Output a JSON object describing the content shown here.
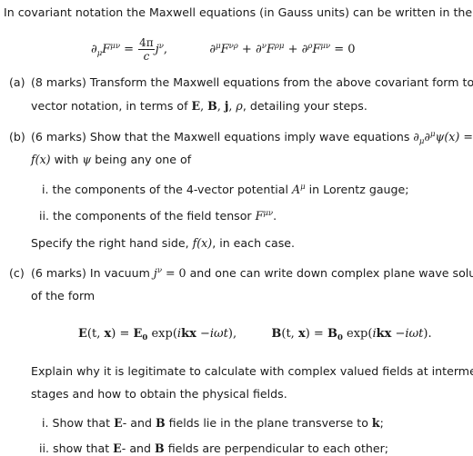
{
  "intro": "In covariant notation the Maxwell equations (in Gauss units) can be written in the form:",
  "equation1": {
    "lhs_op": "∂",
    "lhs_op_sub": "μ",
    "lhs_F": "F",
    "lhs_F_sup": "μν",
    "eq": " = ",
    "frac_num": "4π",
    "frac_den": "c",
    "rhs_j": "j",
    "rhs_j_sup": "ν",
    "comma": ","
  },
  "equation2": {
    "t1_op": "∂",
    "t1_op_sup": "μ",
    "t1_F": "F",
    "t1_F_sup": "νρ",
    "plus1": " + ",
    "t2_op": "∂",
    "t2_op_sup": "ν",
    "t2_F": "F",
    "t2_F_sup": "ρμ",
    "plus2": " + ",
    "t3_op": "∂",
    "t3_op_sup": "ρ",
    "t3_F": "F",
    "t3_F_sup": "μν",
    "rhs": " = 0"
  },
  "part_a": {
    "label": "(a)",
    "marks": "(8 marks)",
    "line1": "Transform the Maxwell equations from the above covariant form to",
    "line2_pre": "vector notation, in terms of ",
    "line2_E": "E",
    "line2_B": "B",
    "line2_j": "j",
    "line2_rho": "ρ",
    "line2_post": ", detailing your steps."
  },
  "part_b": {
    "label": "(b)",
    "marks": "(6 marks)",
    "line1_pre": "Show that the Maxwell equations imply wave equations ",
    "line1_math_op1": "∂",
    "line1_math_op1_sub": "μ",
    "line1_math_op2": "∂",
    "line1_math_op2_sup": "μ",
    "line1_math_psi": "ψ(x)",
    "line1_eq": " =",
    "line2_fx": "f(x)",
    "line2_mid": " with ",
    "line2_psi": "ψ",
    "line2_post": " being any one of",
    "items": [
      {
        "marker": "i.",
        "pre": "the components of the 4-vector potential ",
        "math": "A",
        "math_sup": "μ",
        "post": " in Lorentz gauge;"
      },
      {
        "marker": "ii.",
        "pre": "the components of the field tensor ",
        "math": "F",
        "math_sup": "μν",
        "post": "."
      }
    ],
    "specify_pre": "Specify the right hand side, ",
    "specify_math": "f(x)",
    "specify_post": ", in each case."
  },
  "part_c": {
    "label": "(c)",
    "marks": "(6 marks)",
    "line1_pre": "In vacuum ",
    "line1_math_j": "j",
    "line1_math_j_sup": "ν",
    "line1_math_eq": " = 0",
    "line1_post": " and one can write down complex plane wave solutions",
    "line2": "of the form",
    "eqE": {
      "lhs": "E",
      "args": "(t, ",
      "x": "x",
      "close": ")",
      "eq": " = ",
      "amp": "E",
      "amp_sub": "0",
      "exp": " exp(",
      "i": "i",
      "k": "k",
      "xx": "x",
      "minus": " −",
      "iwt": "iωt",
      "end": "),"
    },
    "eqB": {
      "lhs": "B",
      "args": "(t, ",
      "x": "x",
      "close": ")",
      "eq": " = ",
      "amp": "B",
      "amp_sub": "0",
      "exp": " exp(",
      "i": "i",
      "k": "k",
      "xx": "x",
      "minus": " −",
      "iwt": "iωt",
      "end": ")."
    },
    "explain_line1": "Explain why it is legitimate to calculate with complex valued fields at intermediate",
    "explain_line2": "stages and how to obtain the physical fields.",
    "items": [
      {
        "marker": "i.",
        "pre": "Show that ",
        "E": "E",
        "mid": "- and ",
        "B": "B",
        "post": " fields lie in the plane transverse to ",
        "k": "k",
        "end": ";"
      },
      {
        "marker": "ii.",
        "pre": "show that ",
        "E": "E",
        "mid": "- and ",
        "B": "B",
        "post": " fields are perpendicular to each other;"
      }
    ]
  }
}
